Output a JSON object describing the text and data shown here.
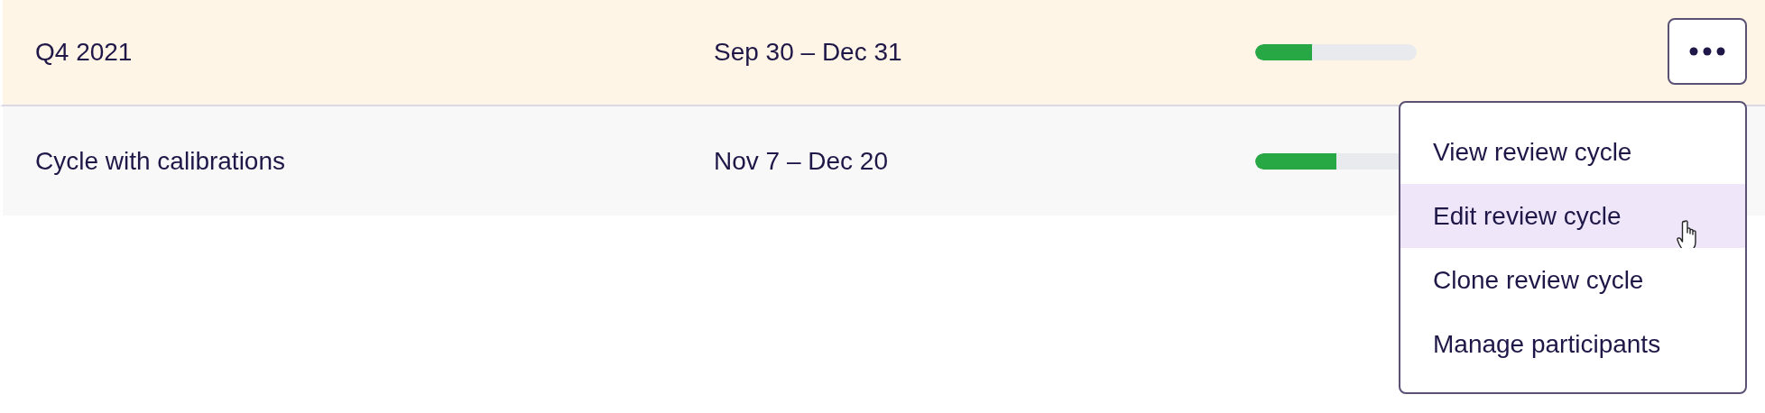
{
  "rows": [
    {
      "name": "Q4 2021",
      "dates": "Sep 30 – Dec 31",
      "level": 0.35,
      "selected": true
    },
    {
      "name": "Cycle with calibrations",
      "dates": "Nov 7 – Dec 20",
      "level": 0.5,
      "selected": false
    }
  ],
  "menu": {
    "items": [
      {
        "label": "View review cycle",
        "selected": false
      },
      {
        "label": "Edit review cycle",
        "selected": true
      },
      {
        "label": "Clone review cycle",
        "selected": false
      },
      {
        "label": "Manage participants",
        "selected": false
      }
    ]
  }
}
